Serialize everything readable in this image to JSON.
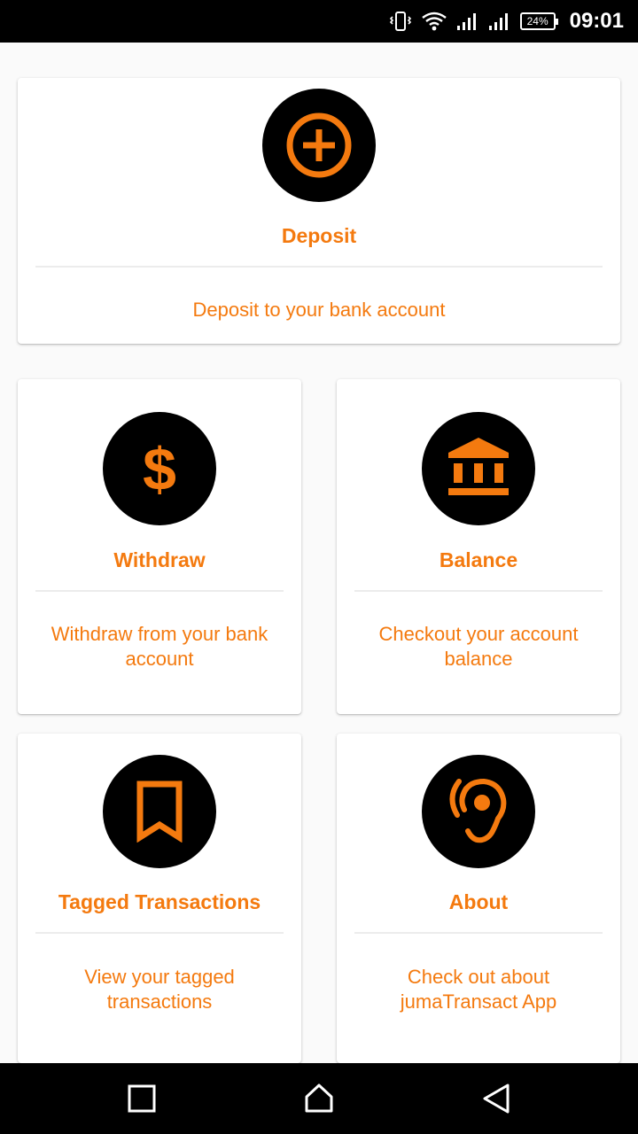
{
  "status_bar": {
    "battery": "24%",
    "time": "09:01"
  },
  "colors": {
    "accent": "#f47a0f",
    "icon_bg": "#000000"
  },
  "cards": {
    "deposit": {
      "icon": "plus-circle-icon",
      "title": "Deposit",
      "description": "Deposit to your bank account"
    },
    "withdraw": {
      "icon": "dollar-icon",
      "title": "Withdraw",
      "description": "Withdraw from your bank account"
    },
    "balance": {
      "icon": "bank-icon",
      "title": "Balance",
      "description": "Checkout your account balance"
    },
    "tagged": {
      "icon": "bookmark-icon",
      "title": "Tagged Transactions",
      "description": "View your tagged transactions"
    },
    "about": {
      "icon": "hearing-icon",
      "title": "About",
      "description": "Check out about jumaTransact App"
    }
  },
  "nav": {
    "recent": "recent-apps-icon",
    "home": "home-icon",
    "back": "back-icon"
  }
}
